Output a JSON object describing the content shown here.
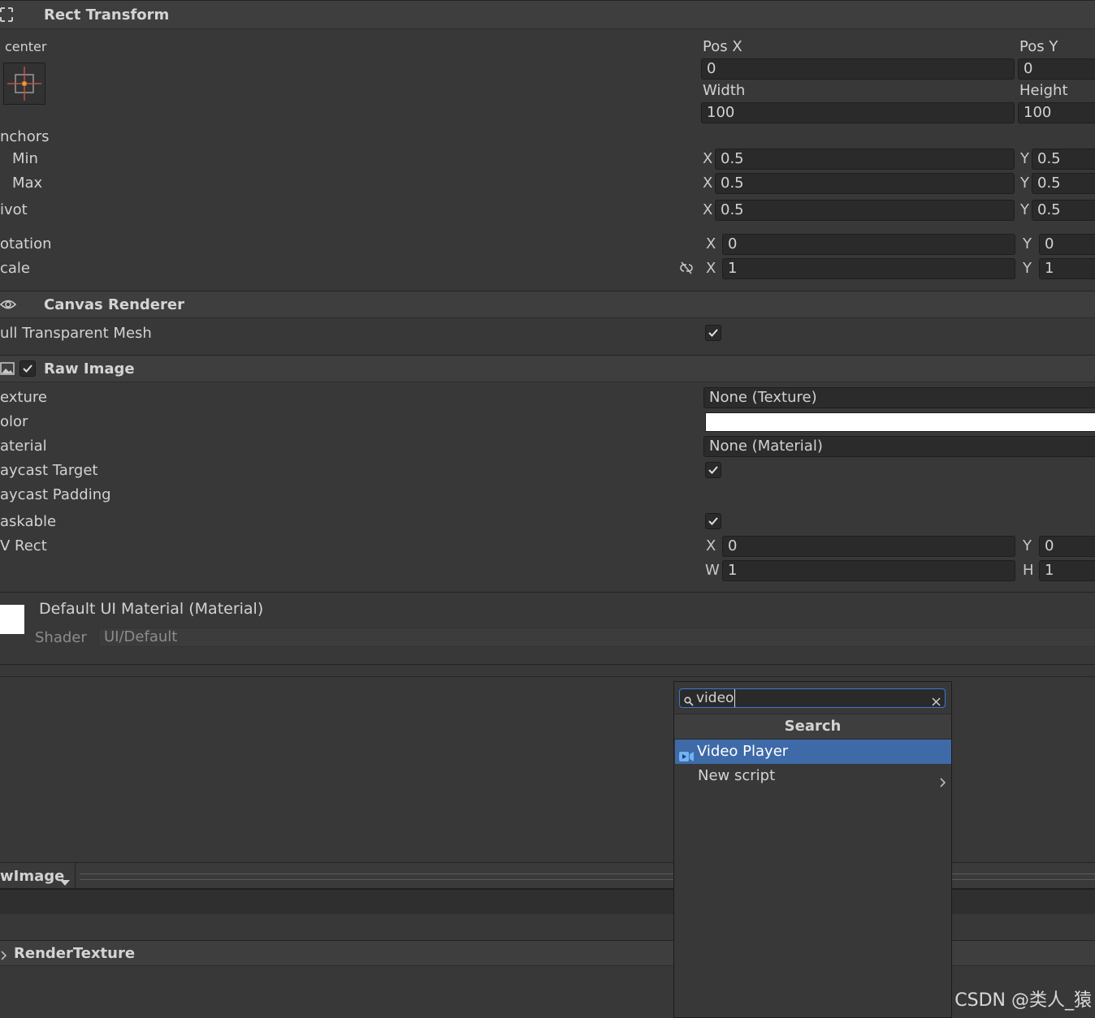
{
  "rect_transform": {
    "title": "Rect Transform",
    "anchor_preset": "center",
    "pos_x_label": "Pos X",
    "pos_x": "0",
    "pos_y_label": "Pos Y",
    "pos_y": "0",
    "width_label": "Width",
    "width": "100",
    "height_label": "Height",
    "height": "100",
    "anchors_label": "nchors",
    "min_label": "Min",
    "min_x": "0.5",
    "min_y": "0.5",
    "max_label": "Max",
    "max_x": "0.5",
    "max_y": "0.5",
    "pivot_label": "ivot",
    "pivot_x": "0.5",
    "pivot_y": "0.5",
    "rotation_label": "otation",
    "rotation_x": "0",
    "rotation_y": "0",
    "scale_label": "cale",
    "scale_x": "1",
    "scale_y": "1",
    "axis_x": "X",
    "axis_y": "Y"
  },
  "canvas_renderer": {
    "title": "Canvas Renderer",
    "cull_label": "ull Transparent Mesh"
  },
  "raw_image": {
    "title": "Raw Image",
    "texture_label": "exture",
    "texture_value": "None (Texture)",
    "color_label": "olor",
    "color_value": "#ffffff",
    "material_label": "aterial",
    "material_value": "None (Material)",
    "raycast_target_label": "aycast Target",
    "raycast_padding_label": "aycast Padding",
    "maskable_label": "askable",
    "uv_rect_label": "V Rect",
    "uv_x": "0",
    "uv_y": "0",
    "uv_w": "1",
    "uv_h": "1",
    "axis_w": "W",
    "axis_h": "H"
  },
  "material": {
    "title": "Default UI Material (Material)",
    "shader_label": "Shader",
    "shader_value": "UI/Default"
  },
  "preview": {
    "object_label": "wImage",
    "render_texture_label": "RenderTexture"
  },
  "add_component_popup": {
    "search_value": "video",
    "header": "Search",
    "items": [
      {
        "label": "Video Player"
      },
      {
        "label": "New script"
      }
    ]
  },
  "watermark": "CSDN @类人_猿",
  "colors": {
    "background": "#383838",
    "header": "#3e3e3e",
    "field": "#2a2a2a",
    "selection": "#3f6aa8",
    "search_focus": "#3a79d1"
  }
}
